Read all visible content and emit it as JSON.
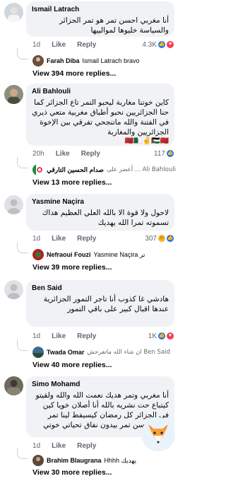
{
  "comments": [
    {
      "author": "Ismail Latrach",
      "text": "أنا مغربي احسن تمر هو تمر الجزائر والسياسة خليوها لموالييها",
      "time": "1d",
      "like": "Like",
      "reply": "Reply",
      "count": "4.3K",
      "reply_preview": {
        "name": "Farah Diba",
        "text": "Ismail Latrach bravo"
      },
      "more_replies": "View 394 more replies..."
    },
    {
      "author": "Ali Bahlouli",
      "text": "كاين خوتنا مغاربة ليحبو التمر تاع الجزائر كما حنا الجزائريين نحبو أطباق مغربية متعي ذيري في الفتنة والله ماتنجحي تفرقي بين الإخوة الجزائريين والمغاربة",
      "emoji": "🇲🇦🇩🇿✌🇵🇸🇲🇦",
      "time": "20h",
      "like": "Like",
      "reply": "Reply",
      "count": "117",
      "reply_preview": {
        "name": "صدام الحسين التارقي",
        "text": "Ali Bahlouli ... أعضر على"
      },
      "more_replies": "View 13 more replies..."
    },
    {
      "author": "Yasmine Naçira",
      "text": "لاحول ولا قوة الا بالله العلي العظيم هداك تسموته تمرا الله يهديك",
      "time": "1d",
      "like": "Like",
      "reply": "Reply",
      "count": "307",
      "reply_preview": {
        "name": "Nefraoui Fouzi",
        "text": "Yasmine Naçira تر"
      },
      "more_replies": "View 39 more replies..."
    },
    {
      "author": "Ben Said",
      "text": "هادشي غا كذوب أنا تاجر التمور الجزائرية عندها اقبال كبير على باقي التمور",
      "time": "1d",
      "like": "Like",
      "reply": "Reply",
      "count": "1K",
      "reply_preview": {
        "name": "Twada Omar",
        "text": "Ben Said ان شاء الله ماتفرحش"
      },
      "more_replies": "View 40 more replies..."
    },
    {
      "author": "Simo Mohamd",
      "text": "أنا مغربي وتمر هديك نعمت الله والله ولقيتو كيتباع حت نشريه بالله أنا أصلان خويا كين في الجزائر كل رمضان كيسيفط لينا تمر زوين أحسن تمر بيدون نفاق تحياتي خوتي جزائر",
      "time": "1d",
      "like": "Like",
      "reply": "Reply",
      "reply_preview": {
        "name": "Brahim Blaugrana",
        "text": "Hhhh يهديك"
      },
      "more_replies": "View 30 more replies..."
    }
  ],
  "colors": {
    "bubble": "#f0f2f5",
    "meta": "#65676b",
    "like_blue": "#1877f2",
    "love_red": "#f33e58"
  }
}
